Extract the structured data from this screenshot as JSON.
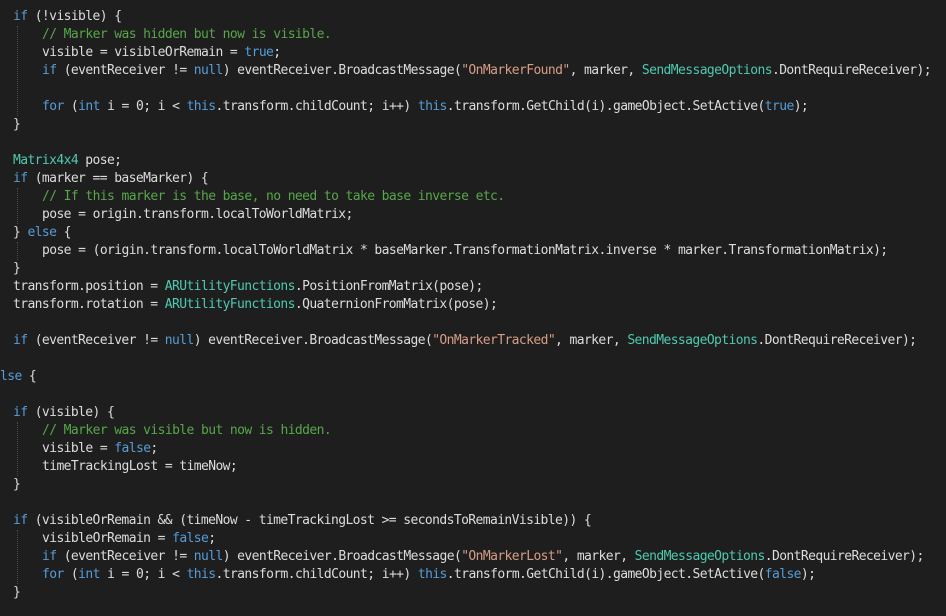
{
  "editor": {
    "lines": [
      {
        "indent": 0,
        "tokens": [
          [
            "kw",
            "if"
          ],
          [
            "id",
            " (!visible) {"
          ]
        ]
      },
      {
        "indent": 1,
        "tokens": [
          [
            "cm",
            "// Marker was hidden but now is visible."
          ]
        ]
      },
      {
        "indent": 1,
        "tokens": [
          [
            "id",
            "visible = visibleOrRemain = "
          ],
          [
            "kw",
            "true"
          ],
          [
            "id",
            ";"
          ]
        ]
      },
      {
        "indent": 1,
        "tokens": [
          [
            "kw",
            "if"
          ],
          [
            "id",
            " (eventReceiver != "
          ],
          [
            "kw",
            "null"
          ],
          [
            "id",
            ") eventReceiver.BroadcastMessage("
          ],
          [
            "str",
            "\"OnMarkerFound\""
          ],
          [
            "id",
            ", marker, "
          ],
          [
            "ty",
            "SendMessageOptions"
          ],
          [
            "id",
            ".DontRequireReceiver);"
          ]
        ]
      },
      {
        "indent": 1,
        "tokens": []
      },
      {
        "indent": 1,
        "tokens": [
          [
            "kw",
            "for"
          ],
          [
            "id",
            " ("
          ],
          [
            "kw",
            "int"
          ],
          [
            "id",
            " i = 0; i < "
          ],
          [
            "kw",
            "this"
          ],
          [
            "id",
            ".transform.childCount; i++) "
          ],
          [
            "kw",
            "this"
          ],
          [
            "id",
            ".transform.GetChild(i).gameObject.SetActive("
          ],
          [
            "kw",
            "true"
          ],
          [
            "id",
            ");"
          ]
        ]
      },
      {
        "indent": 0,
        "tokens": [
          [
            "id",
            "}"
          ]
        ]
      },
      {
        "indent": 0,
        "tokens": []
      },
      {
        "indent": 0,
        "tokens": [
          [
            "ty",
            "Matrix4x4"
          ],
          [
            "id",
            " pose;"
          ]
        ]
      },
      {
        "indent": 0,
        "tokens": [
          [
            "kw",
            "if"
          ],
          [
            "id",
            " (marker == baseMarker) {"
          ]
        ]
      },
      {
        "indent": 1,
        "tokens": [
          [
            "cm",
            "// If this marker is the base, no need to take base inverse etc."
          ]
        ]
      },
      {
        "indent": 1,
        "tokens": [
          [
            "id",
            "pose = origin.transform.localToWorldMatrix;"
          ]
        ]
      },
      {
        "indent": 0,
        "tokens": [
          [
            "id",
            "} "
          ],
          [
            "kw",
            "else"
          ],
          [
            "id",
            " {"
          ]
        ]
      },
      {
        "indent": 1,
        "tokens": [
          [
            "id",
            "pose = (origin.transform.localToWorldMatrix * baseMarker.TransformationMatrix.inverse * marker.TransformationMatrix);"
          ]
        ]
      },
      {
        "indent": 0,
        "tokens": [
          [
            "id",
            "}"
          ]
        ]
      },
      {
        "indent": 0,
        "tokens": [
          [
            "id",
            "transform.position = "
          ],
          [
            "ty",
            "ARUtilityFunctions"
          ],
          [
            "id",
            ".PositionFromMatrix(pose);"
          ]
        ]
      },
      {
        "indent": 0,
        "tokens": [
          [
            "id",
            "transform.rotation = "
          ],
          [
            "ty",
            "ARUtilityFunctions"
          ],
          [
            "id",
            ".QuaternionFromMatrix(pose);"
          ]
        ]
      },
      {
        "indent": 0,
        "tokens": []
      },
      {
        "indent": 0,
        "tokens": [
          [
            "kw",
            "if"
          ],
          [
            "id",
            " (eventReceiver != "
          ],
          [
            "kw",
            "null"
          ],
          [
            "id",
            ") eventReceiver.BroadcastMessage("
          ],
          [
            "str",
            "\"OnMarkerTracked\""
          ],
          [
            "id",
            ", marker, "
          ],
          [
            "ty",
            "SendMessageOptions"
          ],
          [
            "id",
            ".DontRequireReceiver);"
          ]
        ]
      },
      {
        "indent": 0,
        "tokens": []
      },
      {
        "indent": -1,
        "tokens": [
          [
            "kw",
            "lse"
          ],
          [
            "id",
            " {"
          ]
        ]
      },
      {
        "indent": 0,
        "tokens": []
      },
      {
        "indent": 0,
        "tokens": [
          [
            "kw",
            "if"
          ],
          [
            "id",
            " (visible) {"
          ]
        ]
      },
      {
        "indent": 1,
        "tokens": [
          [
            "cm",
            "// Marker was visible but now is hidden."
          ]
        ]
      },
      {
        "indent": 1,
        "tokens": [
          [
            "id",
            "visible = "
          ],
          [
            "kw",
            "false"
          ],
          [
            "id",
            ";"
          ]
        ]
      },
      {
        "indent": 1,
        "tokens": [
          [
            "id",
            "timeTrackingLost = timeNow;"
          ]
        ]
      },
      {
        "indent": 0,
        "tokens": [
          [
            "id",
            "}"
          ]
        ]
      },
      {
        "indent": 0,
        "tokens": []
      },
      {
        "indent": 0,
        "tokens": [
          [
            "kw",
            "if"
          ],
          [
            "id",
            " (visibleOrRemain && (timeNow - timeTrackingLost >= secondsToRemainVisible)) {"
          ]
        ]
      },
      {
        "indent": 1,
        "tokens": [
          [
            "id",
            "visibleOrRemain = "
          ],
          [
            "kw",
            "false"
          ],
          [
            "id",
            ";"
          ]
        ]
      },
      {
        "indent": 1,
        "tokens": [
          [
            "kw",
            "if"
          ],
          [
            "id",
            " (eventReceiver != "
          ],
          [
            "kw",
            "null"
          ],
          [
            "id",
            ") eventReceiver.BroadcastMessage("
          ],
          [
            "str",
            "\"OnMarkerLost\""
          ],
          [
            "id",
            ", marker, "
          ],
          [
            "ty",
            "SendMessageOptions"
          ],
          [
            "id",
            ".DontRequireReceiver);"
          ]
        ]
      },
      {
        "indent": 1,
        "tokens": [
          [
            "kw",
            "for"
          ],
          [
            "id",
            " ("
          ],
          [
            "kw",
            "int"
          ],
          [
            "id",
            " i = 0; i < "
          ],
          [
            "kw",
            "this"
          ],
          [
            "id",
            ".transform.childCount; i++) "
          ],
          [
            "kw",
            "this"
          ],
          [
            "id",
            ".transform.GetChild(i).gameObject.SetActive("
          ],
          [
            "kw",
            "false"
          ],
          [
            "id",
            ");"
          ]
        ]
      },
      {
        "indent": 0,
        "tokens": [
          [
            "id",
            "}"
          ]
        ]
      }
    ],
    "colors": {
      "background": "#1e1e1e",
      "keyword": "#569cd6",
      "type": "#4ec9b0",
      "string": "#d69d85",
      "comment": "#57a64a",
      "identifier": "#dcdcdc"
    }
  }
}
